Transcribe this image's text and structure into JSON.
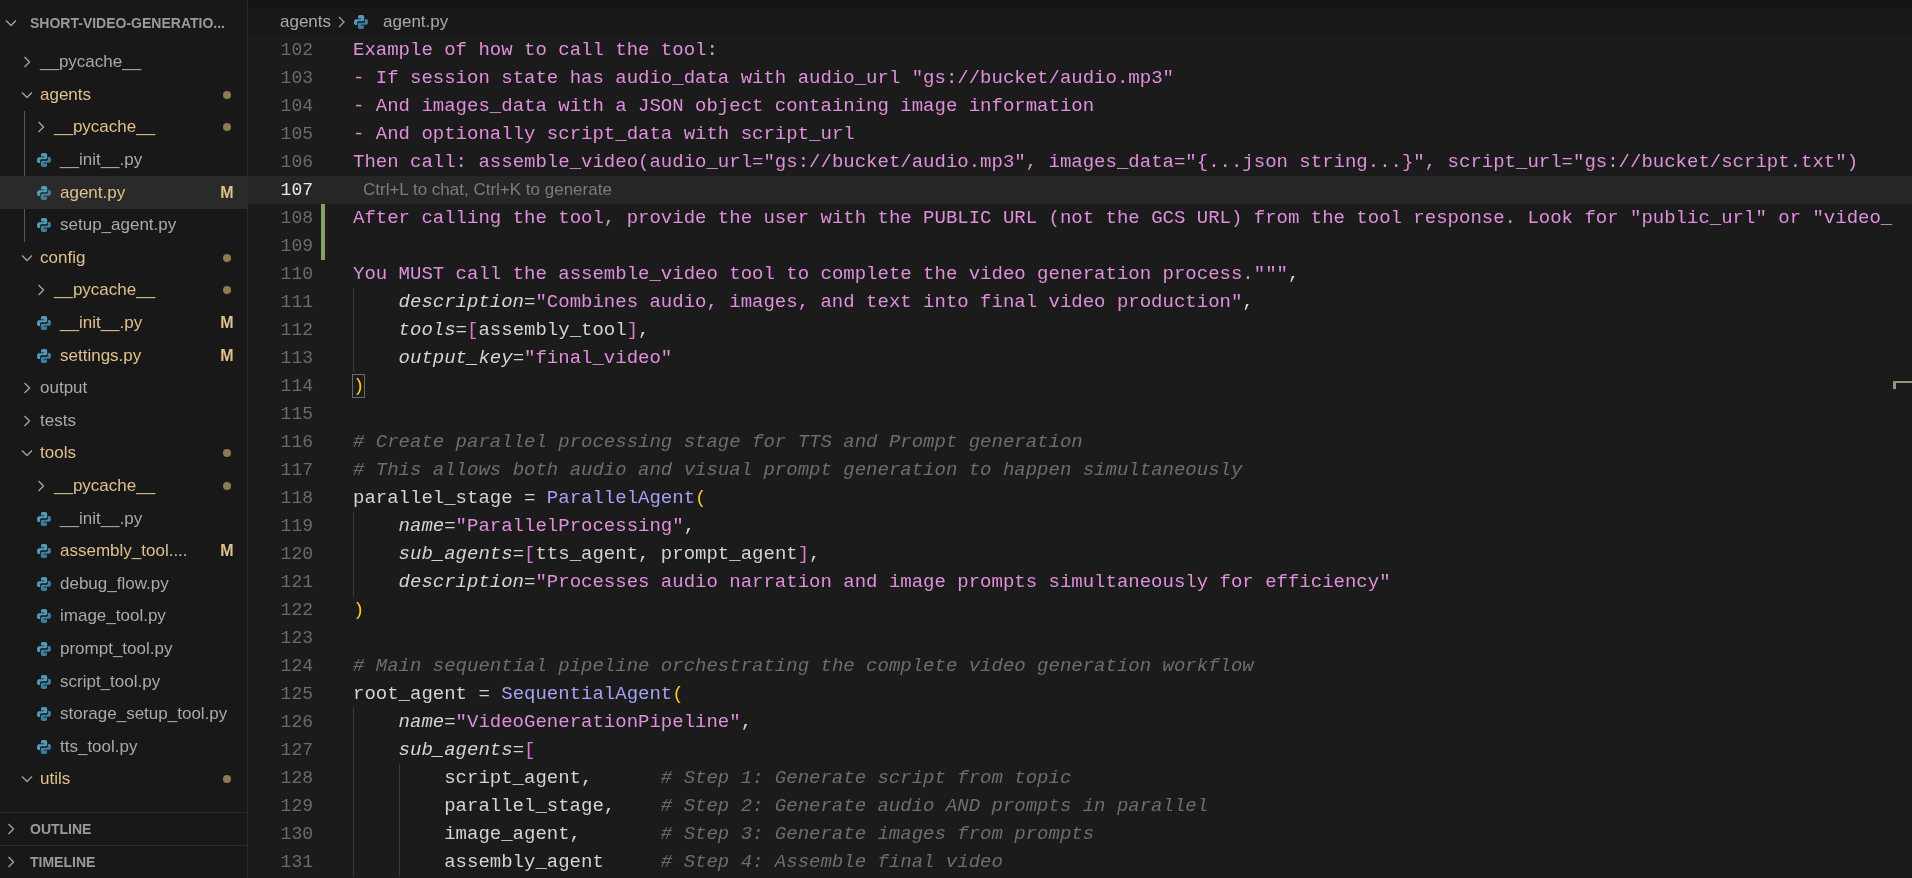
{
  "sidebar": {
    "title": "SHORT-VIDEO-GENERATIO...",
    "expanded": true,
    "tree": [
      {
        "label": "__pycache__",
        "kind": "folder",
        "expanded": false,
        "modified": false,
        "dot": false,
        "selected": false
      },
      {
        "label": "agents",
        "kind": "folder",
        "expanded": true,
        "modified": true,
        "dot": true,
        "selected": false,
        "children": [
          {
            "label": "__pycache__",
            "kind": "folder",
            "expanded": false,
            "modified": true,
            "dot": true,
            "selected": false
          },
          {
            "label": "__init__.py",
            "kind": "file",
            "modified": false,
            "dot": false,
            "selected": false
          },
          {
            "label": "agent.py",
            "kind": "file",
            "modified": true,
            "dot": false,
            "badge": "M",
            "selected": true
          },
          {
            "label": "setup_agent.py",
            "kind": "file",
            "modified": false,
            "dot": false,
            "selected": false
          }
        ]
      },
      {
        "label": "config",
        "kind": "folder",
        "expanded": true,
        "modified": true,
        "dot": true,
        "selected": false,
        "children": [
          {
            "label": "__pycache__",
            "kind": "folder",
            "expanded": false,
            "modified": true,
            "dot": true,
            "selected": false
          },
          {
            "label": "__init__.py",
            "kind": "file",
            "modified": true,
            "dot": false,
            "badge": "M",
            "selected": false
          },
          {
            "label": "settings.py",
            "kind": "file",
            "modified": true,
            "dot": false,
            "badge": "M",
            "selected": false
          }
        ]
      },
      {
        "label": "output",
        "kind": "folder",
        "expanded": false,
        "modified": false,
        "dot": false,
        "selected": false
      },
      {
        "label": "tests",
        "kind": "folder",
        "expanded": false,
        "modified": false,
        "dot": false,
        "selected": false
      },
      {
        "label": "tools",
        "kind": "folder",
        "expanded": true,
        "modified": true,
        "dot": true,
        "selected": false,
        "children": [
          {
            "label": "__pycache__",
            "kind": "folder",
            "expanded": false,
            "modified": true,
            "dot": true,
            "selected": false
          },
          {
            "label": "__init__.py",
            "kind": "file",
            "modified": false,
            "dot": false,
            "selected": false
          },
          {
            "label": "assembly_tool....",
            "kind": "file",
            "modified": true,
            "dot": false,
            "badge": "M",
            "selected": false
          },
          {
            "label": "debug_flow.py",
            "kind": "file",
            "modified": false,
            "dot": false,
            "selected": false
          },
          {
            "label": "image_tool.py",
            "kind": "file",
            "modified": false,
            "dot": false,
            "selected": false
          },
          {
            "label": "prompt_tool.py",
            "kind": "file",
            "modified": false,
            "dot": false,
            "selected": false
          },
          {
            "label": "script_tool.py",
            "kind": "file",
            "modified": false,
            "dot": false,
            "selected": false
          },
          {
            "label": "storage_setup_tool.py",
            "kind": "file",
            "modified": false,
            "dot": false,
            "selected": false
          },
          {
            "label": "tts_tool.py",
            "kind": "file",
            "modified": false,
            "dot": false,
            "selected": false
          }
        ]
      },
      {
        "label": "utils",
        "kind": "folder",
        "expanded": true,
        "modified": true,
        "dot": true,
        "selected": false
      }
    ],
    "sections": [
      {
        "label": "OUTLINE",
        "expanded": false
      },
      {
        "label": "TIMELINE",
        "expanded": false
      }
    ]
  },
  "breadcrumb": [
    {
      "label": "agents",
      "kind": "folder"
    },
    {
      "label": "agent.py",
      "kind": "file"
    }
  ],
  "editor": {
    "lines": [
      {
        "number": "102",
        "current": false,
        "changed": false,
        "tokens": [
          {
            "t": "Example of how to call the tool:",
            "kind": "str"
          }
        ]
      },
      {
        "number": "103",
        "current": false,
        "changed": false,
        "tokens": [
          {
            "t": "- If session state has audio_data with audio_url \"gs://bucket/audio.mp3\"",
            "kind": "str"
          }
        ]
      },
      {
        "number": "104",
        "current": false,
        "changed": false,
        "tokens": [
          {
            "t": "- And images_data with a JSON object containing image information",
            "kind": "str"
          }
        ]
      },
      {
        "number": "105",
        "current": false,
        "changed": false,
        "tokens": [
          {
            "t": "- And optionally script_data with script_url",
            "kind": "str"
          }
        ]
      },
      {
        "number": "106",
        "current": false,
        "changed": false,
        "tokens": [
          {
            "t": "Then call: assemble_video(audio_url=\"gs://bucket/audio.mp3\", images_data=\"{...json string...}\", script_url=\"gs://bucket/script.txt\")",
            "kind": "str"
          }
        ]
      },
      {
        "number": "107",
        "current": true,
        "changed": false,
        "hint": "Ctrl+L to chat, Ctrl+K to generate"
      },
      {
        "number": "108",
        "current": false,
        "changed": true,
        "tokens": [
          {
            "t": "After calling the tool, provide the user with the PUBLIC URL (not the GCS URL) from the tool response. Look for \"public_url\" or \"video_",
            "kind": "str"
          }
        ]
      },
      {
        "number": "109",
        "current": false,
        "changed": true
      },
      {
        "number": "110",
        "current": false,
        "changed": false,
        "tokens": [
          {
            "t": "You MUST call the assemble_video tool to complete the video generation process.\"\"\"",
            "kind": "str"
          },
          {
            "t": ",",
            "kind": "plain"
          }
        ]
      },
      {
        "number": "111",
        "current": false,
        "changed": false,
        "tokens": [
          {
            "t": "    description",
            "kind": "param"
          },
          {
            "t": "=",
            "kind": "plain"
          },
          {
            "t": "\"Combines audio, images, and text into final video production\"",
            "kind": "str"
          },
          {
            "t": ",",
            "kind": "plain"
          }
        ]
      },
      {
        "number": "112",
        "current": false,
        "changed": false,
        "tokens": [
          {
            "t": "    tools",
            "kind": "param"
          },
          {
            "t": "=",
            "kind": "plain"
          },
          {
            "t": "[",
            "kind": "bracket"
          },
          {
            "t": "assembly_tool",
            "kind": "plain"
          },
          {
            "t": "]",
            "kind": "bracket"
          },
          {
            "t": ",",
            "kind": "plain"
          }
        ]
      },
      {
        "number": "113",
        "current": false,
        "changed": false,
        "tokens": [
          {
            "t": "    output_key",
            "kind": "param"
          },
          {
            "t": "=",
            "kind": "plain"
          },
          {
            "t": "\"final_video\"",
            "kind": "str"
          }
        ]
      },
      {
        "number": "114",
        "current": false,
        "changed": false,
        "tokens": [
          {
            "t": ")",
            "kind": "paren",
            "match": true
          }
        ]
      },
      {
        "number": "115",
        "current": false,
        "changed": false
      },
      {
        "number": "116",
        "current": false,
        "changed": false,
        "tokens": [
          {
            "t": "# Create parallel processing stage for TTS and Prompt generation",
            "kind": "comment"
          }
        ]
      },
      {
        "number": "117",
        "current": false,
        "changed": false,
        "tokens": [
          {
            "t": "# This allows both audio and visual prompt generation to happen simultaneously",
            "kind": "comment"
          }
        ]
      },
      {
        "number": "118",
        "current": false,
        "changed": false,
        "tokens": [
          {
            "t": "parallel_stage = ",
            "kind": "plain"
          },
          {
            "t": "ParallelAgent",
            "kind": "class"
          },
          {
            "t": "(",
            "kind": "paren"
          }
        ]
      },
      {
        "number": "119",
        "current": false,
        "changed": false,
        "tokens": [
          {
            "t": "    name",
            "kind": "param"
          },
          {
            "t": "=",
            "kind": "plain"
          },
          {
            "t": "\"ParallelProcessing\"",
            "kind": "str"
          },
          {
            "t": ",",
            "kind": "plain"
          }
        ]
      },
      {
        "number": "120",
        "current": false,
        "changed": false,
        "tokens": [
          {
            "t": "    sub_agents",
            "kind": "param"
          },
          {
            "t": "=",
            "kind": "plain"
          },
          {
            "t": "[",
            "kind": "bracket"
          },
          {
            "t": "tts_agent, prompt_agent",
            "kind": "plain"
          },
          {
            "t": "]",
            "kind": "bracket"
          },
          {
            "t": ",",
            "kind": "plain"
          }
        ]
      },
      {
        "number": "121",
        "current": false,
        "changed": false,
        "tokens": [
          {
            "t": "    description",
            "kind": "param"
          },
          {
            "t": "=",
            "kind": "plain"
          },
          {
            "t": "\"Processes audio narration and image prompts simultaneously for efficiency\"",
            "kind": "str"
          }
        ]
      },
      {
        "number": "122",
        "current": false,
        "changed": false,
        "tokens": [
          {
            "t": ")",
            "kind": "paren"
          }
        ]
      },
      {
        "number": "123",
        "current": false,
        "changed": false
      },
      {
        "number": "124",
        "current": false,
        "changed": false,
        "tokens": [
          {
            "t": "# Main sequential pipeline orchestrating the complete video generation workflow",
            "kind": "comment"
          }
        ]
      },
      {
        "number": "125",
        "current": false,
        "changed": false,
        "tokens": [
          {
            "t": "root_agent = ",
            "kind": "plain"
          },
          {
            "t": "SequentialAgent",
            "kind": "class"
          },
          {
            "t": "(",
            "kind": "paren"
          }
        ]
      },
      {
        "number": "126",
        "current": false,
        "changed": false,
        "tokens": [
          {
            "t": "    name",
            "kind": "param"
          },
          {
            "t": "=",
            "kind": "plain"
          },
          {
            "t": "\"VideoGenerationPipeline\"",
            "kind": "str"
          },
          {
            "t": ",",
            "kind": "plain"
          }
        ]
      },
      {
        "number": "127",
        "current": false,
        "changed": false,
        "tokens": [
          {
            "t": "    sub_agents",
            "kind": "param"
          },
          {
            "t": "=",
            "kind": "plain"
          },
          {
            "t": "[",
            "kind": "bracket"
          }
        ]
      },
      {
        "number": "128",
        "current": false,
        "changed": false,
        "tokens": [
          {
            "t": "        script_agent,      ",
            "kind": "plain"
          },
          {
            "t": "# Step 1: Generate script from topic",
            "kind": "comment"
          }
        ]
      },
      {
        "number": "129",
        "current": false,
        "changed": false,
        "tokens": [
          {
            "t": "        parallel_stage,    ",
            "kind": "plain"
          },
          {
            "t": "# Step 2: Generate audio AND prompts in parallel",
            "kind": "comment"
          }
        ]
      },
      {
        "number": "130",
        "current": false,
        "changed": false,
        "tokens": [
          {
            "t": "        image_agent,       ",
            "kind": "plain"
          },
          {
            "t": "# Step 3: Generate images from prompts",
            "kind": "comment"
          }
        ]
      },
      {
        "number": "131",
        "current": false,
        "changed": false,
        "tokens": [
          {
            "t": "        assembly_agent     ",
            "kind": "plain"
          },
          {
            "t": "# Step 4: Assemble final video",
            "kind": "comment"
          }
        ]
      }
    ]
  }
}
